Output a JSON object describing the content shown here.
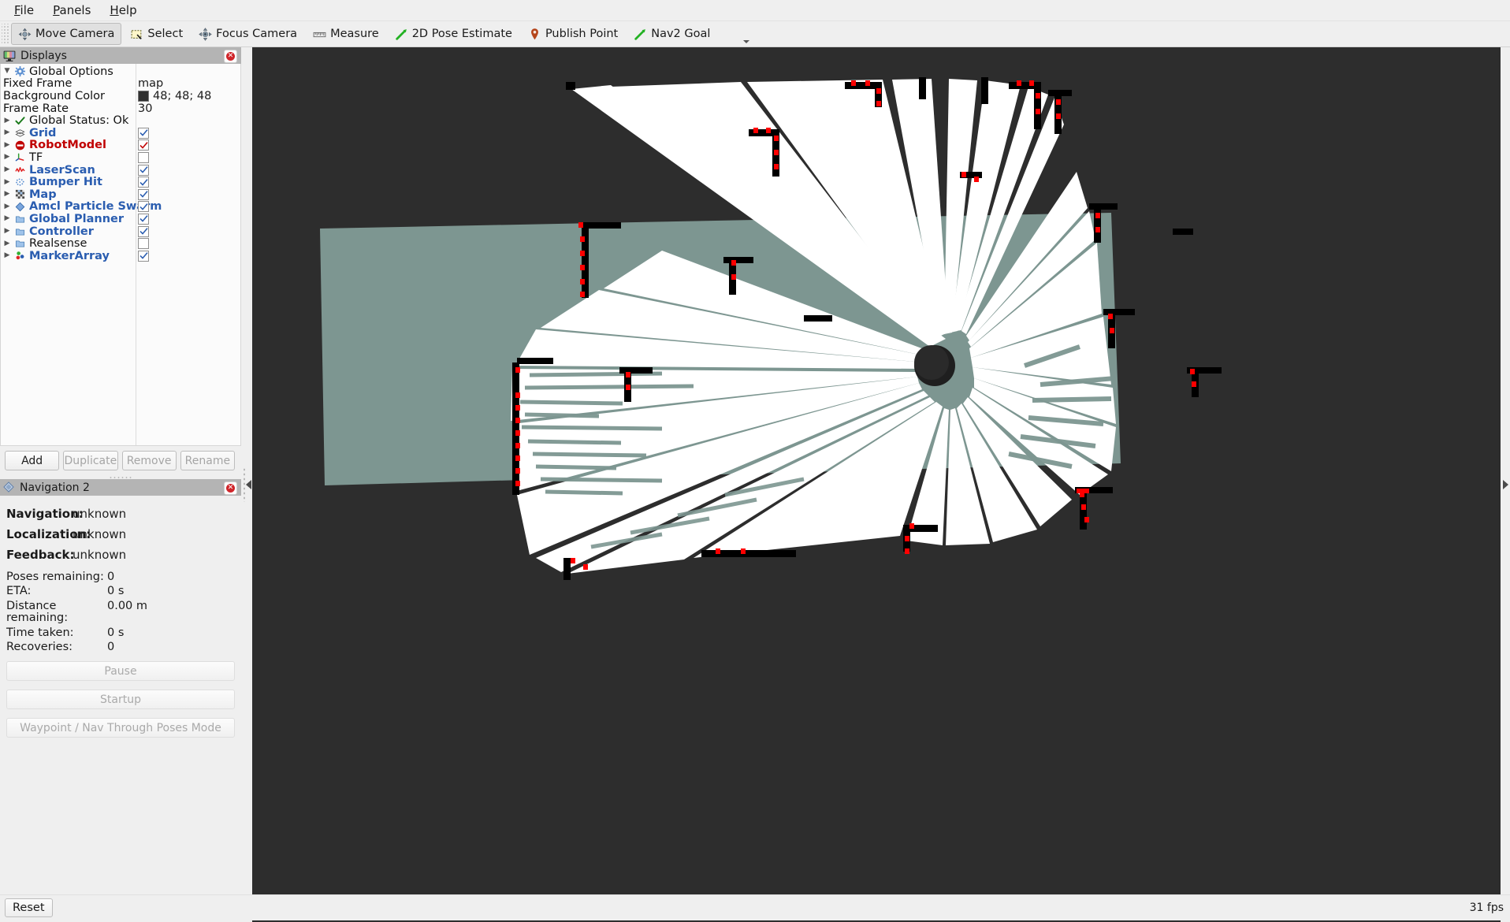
{
  "menu": {
    "items": [
      {
        "label": "File",
        "mnemonic": "F"
      },
      {
        "label": "Panels",
        "mnemonic": "P"
      },
      {
        "label": "Help",
        "mnemonic": "H"
      }
    ]
  },
  "toolbar": {
    "tools": [
      {
        "label": "Move Camera",
        "icon": "move-camera-icon",
        "active": true
      },
      {
        "label": "Select",
        "icon": "select-icon",
        "active": false
      },
      {
        "label": "Focus Camera",
        "icon": "focus-camera-icon",
        "active": false
      },
      {
        "label": "Measure",
        "icon": "measure-icon",
        "active": false
      },
      {
        "label": "2D Pose Estimate",
        "icon": "pose-arrow-icon",
        "active": false
      },
      {
        "label": "Publish Point",
        "icon": "map-pin-icon",
        "active": false
      },
      {
        "label": "Nav2 Goal",
        "icon": "pose-arrow-icon",
        "active": false
      }
    ],
    "add_tool_icon": "plus-icon",
    "remove_tool_icon": "minus-icon",
    "overflow_icon": "chevron-down-icon"
  },
  "displays_panel": {
    "title": "Displays",
    "title_icon": "displays-monitor-icon",
    "close_icon": "close-icon",
    "tree": [
      {
        "label": "Global Options",
        "icon": "gear-icon",
        "expander": "open",
        "style": "plain",
        "indent": 0,
        "value_type": "none"
      },
      {
        "label": "Fixed Frame",
        "icon": "none",
        "expander": "none",
        "style": "plain",
        "indent": 1,
        "value_type": "text",
        "value": "map"
      },
      {
        "label": "Background Color",
        "icon": "none",
        "expander": "none",
        "style": "plain",
        "indent": 1,
        "value_type": "color",
        "value": "48; 48; 48",
        "swatch": "#303030"
      },
      {
        "label": "Frame Rate",
        "icon": "none",
        "expander": "none",
        "style": "plain",
        "indent": 1,
        "value_type": "text",
        "value": "30"
      },
      {
        "label": "Global Status: Ok",
        "icon": "check-icon",
        "expander": "closed",
        "style": "plain",
        "indent": 0,
        "value_type": "none"
      },
      {
        "label": "Grid",
        "icon": "grid-icon",
        "expander": "closed",
        "style": "blue",
        "indent": 0,
        "value_type": "checkbox",
        "checked": true,
        "check_color": "#2a5db0"
      },
      {
        "label": "RobotModel",
        "icon": "error-icon",
        "expander": "closed",
        "style": "red",
        "indent": 0,
        "value_type": "checkbox",
        "checked": true,
        "check_color": "#c00000"
      },
      {
        "label": "TF",
        "icon": "tf-axes-icon",
        "expander": "closed",
        "style": "plain",
        "indent": 0,
        "value_type": "checkbox",
        "checked": false,
        "check_color": "#2a5db0"
      },
      {
        "label": "LaserScan",
        "icon": "laserscan-icon",
        "expander": "closed",
        "style": "blue",
        "indent": 0,
        "value_type": "checkbox",
        "checked": true,
        "check_color": "#2a5db0"
      },
      {
        "label": "Bumper Hit",
        "icon": "pointcloud-icon",
        "expander": "closed",
        "style": "blue",
        "indent": 0,
        "value_type": "checkbox",
        "checked": true,
        "check_color": "#2a5db0"
      },
      {
        "label": "Map",
        "icon": "map-grid-icon",
        "expander": "closed",
        "style": "blue",
        "indent": 0,
        "value_type": "checkbox",
        "checked": true,
        "check_color": "#2a5db0"
      },
      {
        "label": "Amcl Particle Swarm",
        "icon": "pose-array-icon",
        "expander": "closed",
        "style": "blue",
        "indent": 0,
        "value_type": "checkbox",
        "checked": true,
        "check_color": "#2a5db0"
      },
      {
        "label": "Global Planner",
        "icon": "group-folder-icon",
        "expander": "closed",
        "style": "blue",
        "indent": 0,
        "value_type": "checkbox",
        "checked": true,
        "check_color": "#2a5db0"
      },
      {
        "label": "Controller",
        "icon": "group-folder-icon",
        "expander": "closed",
        "style": "blue",
        "indent": 0,
        "value_type": "checkbox",
        "checked": true,
        "check_color": "#2a5db0"
      },
      {
        "label": "Realsense",
        "icon": "group-folder-icon",
        "expander": "closed",
        "style": "plain",
        "indent": 0,
        "value_type": "checkbox",
        "checked": false,
        "check_color": "#2a5db0"
      },
      {
        "label": "MarkerArray",
        "icon": "markerarray-icon",
        "expander": "closed",
        "style": "blue",
        "indent": 0,
        "value_type": "checkbox",
        "checked": true,
        "check_color": "#2a5db0"
      }
    ],
    "buttons": [
      {
        "label": "Add",
        "enabled": true
      },
      {
        "label": "Duplicate",
        "enabled": false
      },
      {
        "label": "Remove",
        "enabled": false
      },
      {
        "label": "Rename",
        "enabled": false
      }
    ]
  },
  "navigation_panel": {
    "title": "Navigation 2",
    "title_icon": "nav2-diamond-icon",
    "close_icon": "close-icon",
    "status": [
      {
        "key": "Navigation:",
        "value": "unknown"
      },
      {
        "key": "Localization:",
        "value": "unknown"
      },
      {
        "key": "Feedback:",
        "value": "unknown"
      }
    ],
    "stats": [
      {
        "key": "Poses remaining:",
        "value": "0"
      },
      {
        "key": "ETA:",
        "value": "0 s"
      },
      {
        "key": "Distance remaining:",
        "value": "0.00 m"
      },
      {
        "key": "Time taken:",
        "value": "0 s"
      },
      {
        "key": "Recoveries:",
        "value": "0"
      }
    ],
    "actions": [
      {
        "label": "Pause",
        "enabled": false
      },
      {
        "label": "Startup",
        "enabled": false
      },
      {
        "label": "Waypoint / Nav Through Poses Mode",
        "enabled": false
      }
    ]
  },
  "viewport": {
    "background_color": "#2d2d2d",
    "map": {
      "unknown_color": "#7d9691",
      "free_color": "#ffffff",
      "occupied_color": "#000000",
      "laserscan_color": "#ff0000",
      "robot_color": "#1f1f1f"
    },
    "collapse_left_icon": "chevron-left-icon",
    "collapse_right_icon": "chevron-right-icon"
  },
  "statusbar": {
    "reset_label": "Reset",
    "fps": "31 fps"
  }
}
